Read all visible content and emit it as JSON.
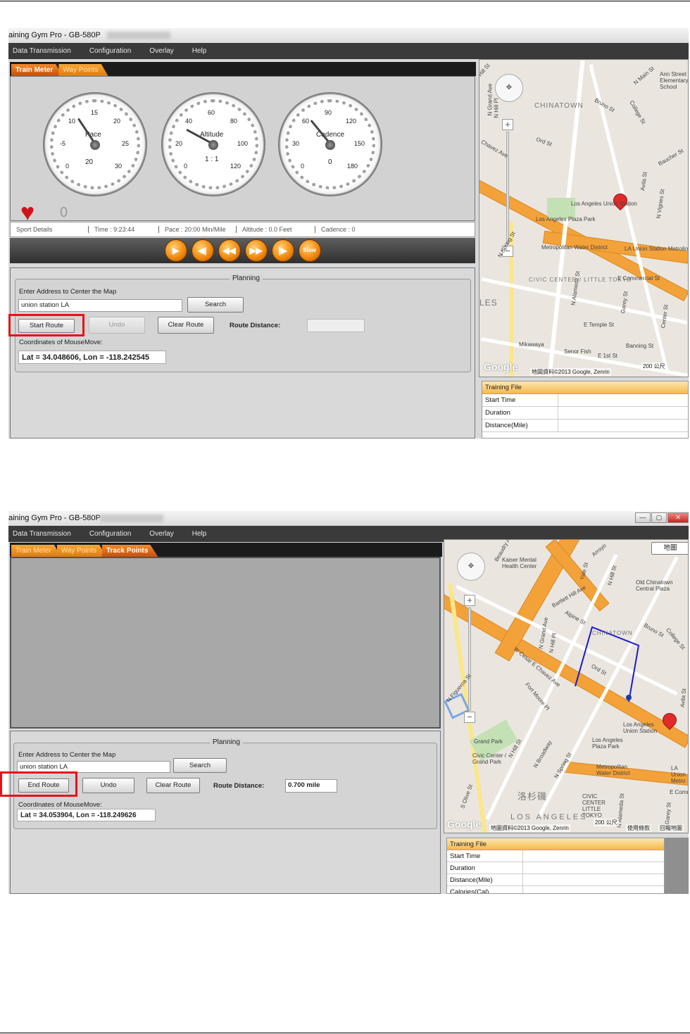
{
  "screen1": {
    "window_title": "aining Gym Pro - GB-580P",
    "menu": [
      "Data Transmission",
      "Configuration",
      "Overlay",
      "Help"
    ],
    "tabs": [
      "Train Meter",
      "Way Points"
    ],
    "active_tab": 0,
    "gauges": [
      {
        "label": "Pace",
        "ticks": [
          "15",
          "10",
          "20",
          "-5",
          "25",
          "0",
          "30"
        ],
        "inner_value": "20",
        "level_pct": 38
      },
      {
        "label": "Altitude",
        "ticks": [
          "60",
          "40",
          "80",
          "20",
          "100",
          "0",
          "120"
        ],
        "inner_value": "1 : 1",
        "level_pct": 28
      },
      {
        "label": "Cadence",
        "ticks": [
          "90",
          "60",
          "120",
          "30",
          "150",
          "0",
          "180"
        ],
        "inner_value": "0",
        "level_pct": 36
      }
    ],
    "heart_rate": "0",
    "sport_bar": [
      "Sport Details",
      "Time : 9:23:44",
      "Pace : 20:00 Min/Mile",
      "Altitude : 0.0 Feet",
      "Cadence : 0"
    ],
    "playback": [
      "▶",
      "◀|",
      "◀◀",
      "▶▶",
      "|▶",
      "Slow"
    ],
    "planning": {
      "title": "Planning",
      "address_label": "Enter Address to Center the Map",
      "address_value": "union station LA",
      "search_label": "Search",
      "route_button": "Start Route",
      "undo_label": "Undo",
      "clear_label": "Clear Route",
      "route_distance_label": "Route Distance:",
      "route_distance_value": "",
      "coords_label": "Coordinates of MouseMove:",
      "coords_value": "Lat = 34.048606, Lon = -118.242545"
    },
    "map": {
      "labels": [
        "CHINATOWN",
        "Los Angeles Union Station",
        "Los Angeles Plaza Park",
        "Metropolitan Water District",
        "LA Union Station Metrolink Station",
        "CIVIC CENTER / LITTLE TOKYO",
        "N Alameda St",
        "N Spring St",
        "E Commercial St",
        "E Temple St",
        "Mikawaya",
        "Senor Fish",
        "E 1st St",
        "Banning St",
        "N Vignes St",
        "N Main St",
        "Ann Street Elementary School",
        "Bruno St",
        "College St",
        "Ord St",
        "Chavez Ave",
        "N Hill Pl",
        "N Grand Ave",
        "Baucher St",
        "Avila St",
        "Center St",
        "Garey St",
        "Hill St",
        "LES"
      ],
      "attribution": "地図資料©2013 Google, Zenrin",
      "scale": "200 公尺",
      "logo": "Google"
    },
    "training_file": {
      "header": "Training File",
      "rows": [
        "Start Time",
        "Duration",
        "Distance(Mile)"
      ]
    }
  },
  "screen2": {
    "window_title": "aining Gym Pro - GB-580P",
    "window_buttons": [
      "—",
      "▢",
      "✕"
    ],
    "menu": [
      "Data Transmission",
      "Configuration",
      "Overlay",
      "Help"
    ],
    "tabs": [
      "Train Meter",
      "Way Points",
      "Track Points"
    ],
    "active_tab": 2,
    "planning": {
      "title": "Planning",
      "address_label": "Enter Address to Center the Map",
      "address_value": "union station LA",
      "search_label": "Search",
      "route_button": "End Route",
      "undo_label": "Undo",
      "clear_label": "Clear Route",
      "route_distance_label": "Route Distance:",
      "route_distance_value": "0.700 mile",
      "coords_label": "Coordinates of MouseMove:",
      "coords_value": "Lat = 34.053904, Lon = -118.249626"
    },
    "map": {
      "map_type_button": "地圖",
      "labels": [
        "Kaiser Mental Health Center",
        "Arroyo",
        "N Hill St",
        "Yale St",
        "Old Chinatown Central Plaza",
        "CHINATOWN",
        "Alpine St",
        "W Cesar E Chavez Ave",
        "N Grand Ave",
        "N Hill Pl",
        "Ord St",
        "Fort Moore Pl",
        "N Figueroa St",
        "Grand Park",
        "Civic Center / Grand Park",
        "N Hill St",
        "N Broadway",
        "N Spring St",
        "Los Angeles Plaza Park",
        "Los Angeles Union Station",
        "Metropolitan Water District",
        "LA Union Metro",
        "CIVIC CENTER LITTLE TOKYO",
        "S Olive St",
        "LOS ANGELES",
        "洛杉磯",
        "N Alameda St",
        "E Comm",
        "Garey St",
        "Avila St",
        "College St",
        "Bruno St",
        "Beaudry Ave",
        "Bartlett Hill Ave"
      ],
      "attribution": "地圖資料©2013 Google, Zenrin",
      "scale": "200 公尺",
      "terms": "使用條款",
      "report": "回報地圖",
      "logo": "Google"
    },
    "training_file": {
      "header": "Training File",
      "rows": [
        "Start Time",
        "Duration",
        "Distance(Mile)",
        "Calories(Cal)"
      ]
    }
  },
  "colors": {
    "highlight": "#e8121b",
    "tab_orange": "#f38a2a",
    "route_line": "#1a1acf",
    "pin": "#e12b2b"
  }
}
